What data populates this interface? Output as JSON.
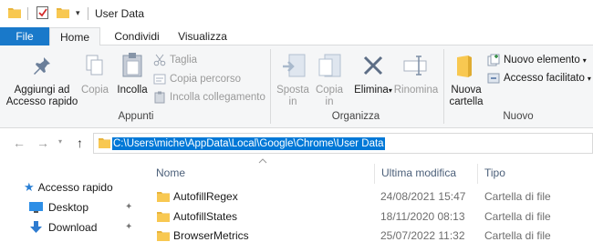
{
  "window": {
    "title": "User Data"
  },
  "tabs": [
    {
      "label": "File"
    },
    {
      "label": "Home"
    },
    {
      "label": "Condividi"
    },
    {
      "label": "Visualizza"
    }
  ],
  "ribbon": {
    "appunti": {
      "group_label": "Appunti",
      "pin_label_1": "Aggiungi ad",
      "pin_label_2": "Accesso rapido",
      "copy_label": "Copia",
      "paste_label": "Incolla",
      "cut_label": "Taglia",
      "copy_path_label": "Copia percorso",
      "paste_shortcut_label": "Incolla collegamento"
    },
    "organizza": {
      "group_label": "Organizza",
      "move_label_1": "Sposta",
      "move_label_2": "in",
      "copy_to_label_1": "Copia",
      "copy_to_label_2": "in",
      "delete_label": "Elimina",
      "rename_label": "Rinomina"
    },
    "nuovo": {
      "group_label": "Nuovo",
      "new_folder_label_1": "Nuova",
      "new_folder_label_2": "cartella",
      "new_item_label": "Nuovo elemento",
      "easy_access_label": "Accesso facilitato"
    }
  },
  "address": {
    "path": "C:\\Users\\miche\\AppData\\Local\\Google\\Chrome\\User Data"
  },
  "columns": {
    "name": "Nome",
    "modified": "Ultima modifica",
    "type": "Tipo"
  },
  "nav_pane": {
    "quick_access": "Accesso rapido",
    "desktop": "Desktop",
    "download": "Download"
  },
  "files": [
    {
      "name": "AutofillRegex",
      "modified": "24/08/2021 15:47",
      "type": "Cartella di file"
    },
    {
      "name": "AutofillStates",
      "modified": "18/11/2020 08:13",
      "type": "Cartella di file"
    },
    {
      "name": "BrowserMetrics",
      "modified": "25/07/2022 11:32",
      "type": "Cartella di file"
    }
  ],
  "colors": {
    "file_tab": "#1979ca",
    "selection": "#0078d7",
    "folder": "#f8c851",
    "column_header_text": "#4c607a"
  }
}
